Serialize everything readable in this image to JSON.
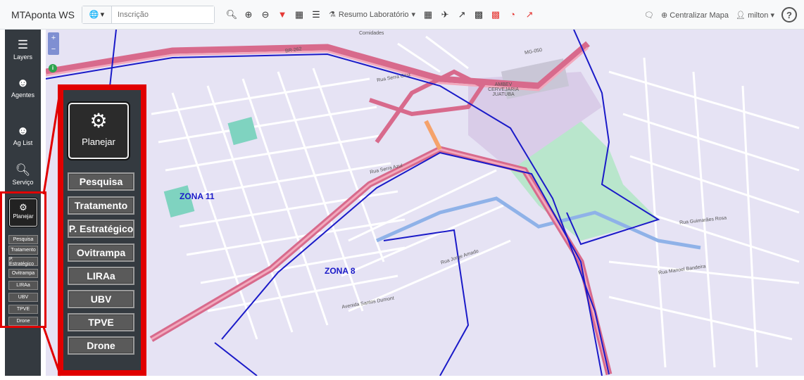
{
  "app": {
    "title": "MTAponta WS"
  },
  "search": {
    "placeholder": "Inscrição"
  },
  "toolbar": {
    "resumo_label": "Resumo Laboratório",
    "centralizar_label": "Centralizar Mapa",
    "user_label": "milton",
    "help_label": "?"
  },
  "sidebar": {
    "items": [
      {
        "label": "Layers"
      },
      {
        "label": "Agentes"
      },
      {
        "label": "Ag List"
      },
      {
        "label": "Serviço"
      }
    ],
    "planejar_label": "Planejar",
    "sub_items": [
      "Pesquisa",
      "Tratamento",
      "P. Estratégico",
      "Ovitrampa",
      "LIRAa",
      "UBV",
      "TPVE",
      "Drone"
    ]
  },
  "zoom": {
    "in": "+",
    "out": "−"
  },
  "map": {
    "zones": [
      "ZONA 11",
      "ZONA 8"
    ],
    "place_labels": [
      "Comidades",
      "AMBEV CERVEJARIA JUATUBA",
      "MG-050",
      "BR-262",
      "Rua Serra Cruz",
      "Rua Serra Azul",
      "Avenida Santos Dumont",
      "Rua Manoel Bandeira",
      "Rua Guimarães Rosa",
      "Rua Jorge Amado"
    ]
  },
  "colors": {
    "highlight": "#e10000",
    "sidebar": "#343a40",
    "map_bg": "#e6e3f4",
    "zone_line": "#1a1ac8",
    "road": "#d86a8c"
  }
}
